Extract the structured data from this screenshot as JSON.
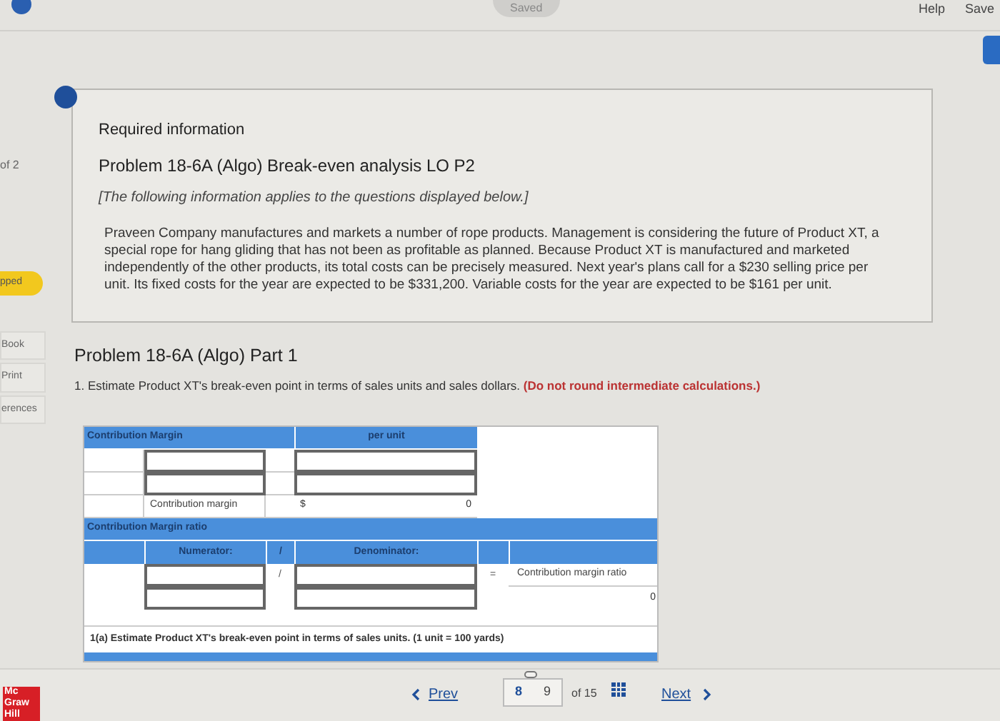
{
  "top_bar": {
    "status": "Saved",
    "links": [
      "Help",
      "Save"
    ]
  },
  "sidebar": {
    "items": [
      {
        "kind": "text",
        "label": "of 2"
      },
      {
        "kind": "badge",
        "label": "pped"
      },
      {
        "kind": "tab",
        "label": "Book"
      },
      {
        "kind": "tab",
        "label": "Print"
      },
      {
        "kind": "tab",
        "label": "erences"
      }
    ]
  },
  "info_card": {
    "heading": "Required information",
    "title": "Problem 18-6A (Algo) Break-even analysis LO P2",
    "note": "[The following information applies to the questions displayed below.]",
    "body": "Praveen Company manufactures and markets a number of rope products. Management is considering the future of Product XT, a special rope for hang gliding that has not been as profitable as planned. Because Product XT is manufactured and marketed independently of the other products, its total costs can be precisely measured. Next year's plans call for a $230 selling price per unit. Its fixed costs for the year are expected to be $331,200. Variable costs for the year are expected to be $161 per unit."
  },
  "part_title": "Problem 18-6A (Algo) Part 1",
  "question": {
    "text": "1. Estimate Product XT's break-even point in terms of sales units and sales dollars.",
    "instruction": "(Do not round intermediate calculations.)"
  },
  "margin_table": {
    "headers": [
      "Contribution Margin",
      "per unit"
    ],
    "rows": [
      {
        "kind": "input"
      },
      {
        "kind": "input"
      },
      {
        "kind": "total",
        "label": "Contribution margin",
        "currency": "$",
        "value": "0"
      }
    ]
  },
  "ratio_table": {
    "header": "Contribution Margin ratio",
    "columns": [
      "Numerator:",
      "/",
      "Denominator:"
    ],
    "divide": "/",
    "equals": "=",
    "result_label": "Contribution margin ratio",
    "result_value": "0"
  },
  "part_a": "1(a) Estimate Product XT's break-even point in terms of sales units. (1 unit = 100 yards)",
  "footer": {
    "logo": [
      "Mc",
      "Graw",
      "Hill"
    ],
    "prev": "Prev",
    "pages": [
      "8",
      "9"
    ],
    "total": "of 15",
    "next": "Next"
  }
}
